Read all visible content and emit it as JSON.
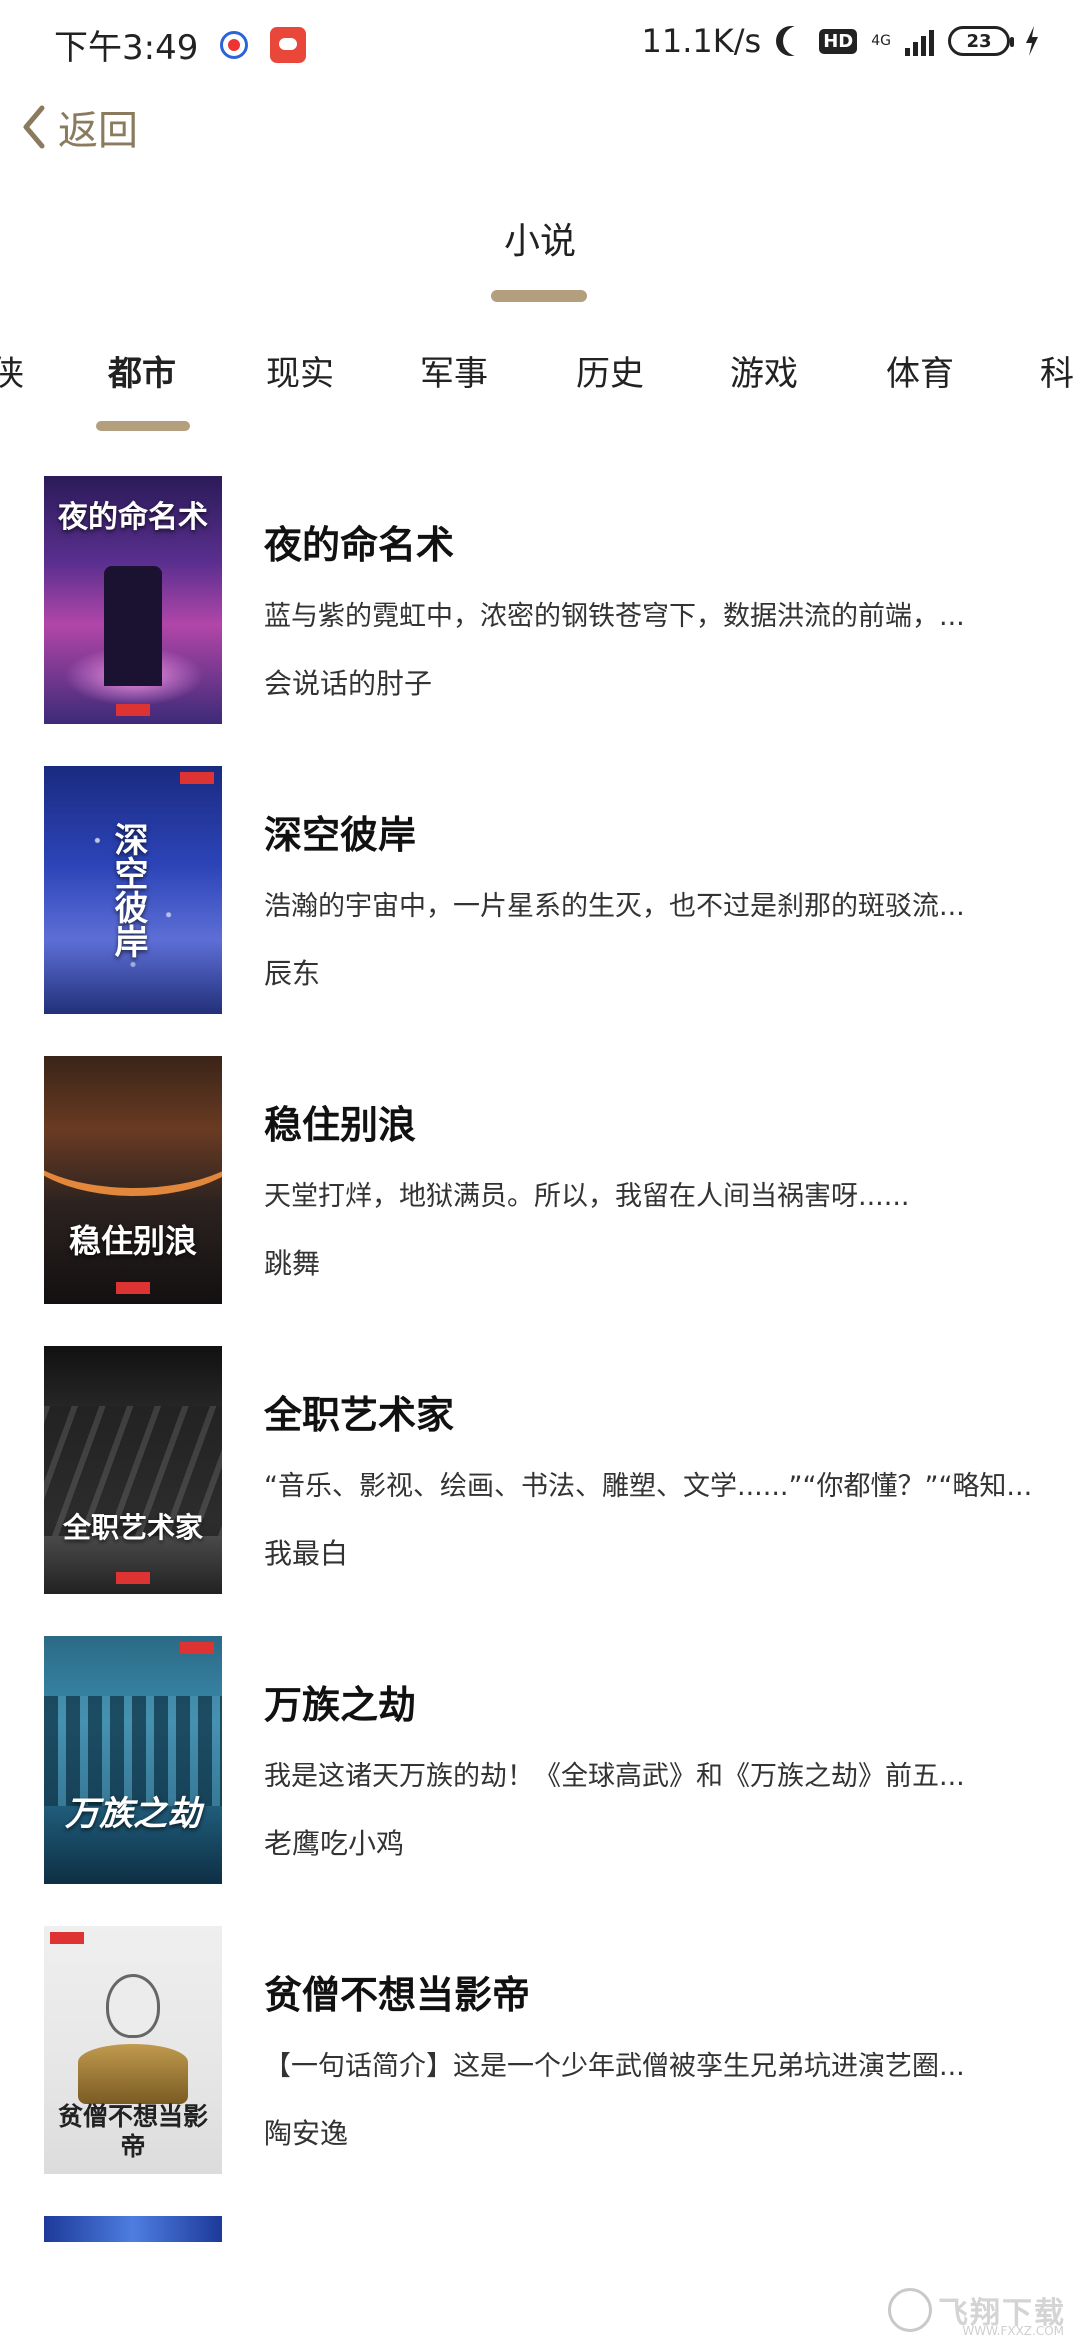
{
  "status_bar": {
    "time": "下午3:49",
    "net_speed": "11.1K/s",
    "network_type": "4G",
    "hd": "HD",
    "battery": "23"
  },
  "header": {
    "back_label": "返回",
    "title": "小说"
  },
  "tabs": [
    {
      "label": "侠"
    },
    {
      "label": "都市",
      "active": true
    },
    {
      "label": "现实"
    },
    {
      "label": "军事"
    },
    {
      "label": "历史"
    },
    {
      "label": "游戏"
    },
    {
      "label": "体育"
    },
    {
      "label": "科"
    }
  ],
  "books": [
    {
      "title": "夜的命名术",
      "desc": "蓝与紫的霓虹中，浓密的钢铁苍穹下，数据洪流的前端，...",
      "author": "会说话的肘子",
      "cover_text": "夜的命名术"
    },
    {
      "title": "深空彼岸",
      "desc": "浩瀚的宇宙中，一片星系的生灭，也不过是刹那的斑驳流...",
      "author": "辰东",
      "cover_text": "深空彼岸"
    },
    {
      "title": "稳住别浪",
      "desc": "天堂打烊，地狱满员。所以，我留在人间当祸害呀......",
      "author": "跳舞",
      "cover_text": "稳住别浪"
    },
    {
      "title": "全职艺术家",
      "desc": "“音乐、影视、绘画、书法、雕塑、文学......”“你都懂？”“略知...",
      "author": "我最白",
      "cover_text": "全职艺术家"
    },
    {
      "title": "万族之劫",
      "desc": "我是这诸天万族的劫！《全球高武》和《万族之劫》前五...",
      "author": "老鹰吃小鸡",
      "cover_text": "万族之劫"
    },
    {
      "title": "贫僧不想当影帝",
      "desc": "【一句话简介】这是一个少年武僧被孪生兄弟坑进演艺圈...",
      "author": "陶安逸",
      "cover_text": "贫僧不想当影帝"
    }
  ],
  "watermark": {
    "text": "飞翔下载",
    "url_text": "WWW.FXXZ.COM"
  },
  "colors": {
    "accent": "#b39e7e",
    "back": "#8a7a5e"
  }
}
